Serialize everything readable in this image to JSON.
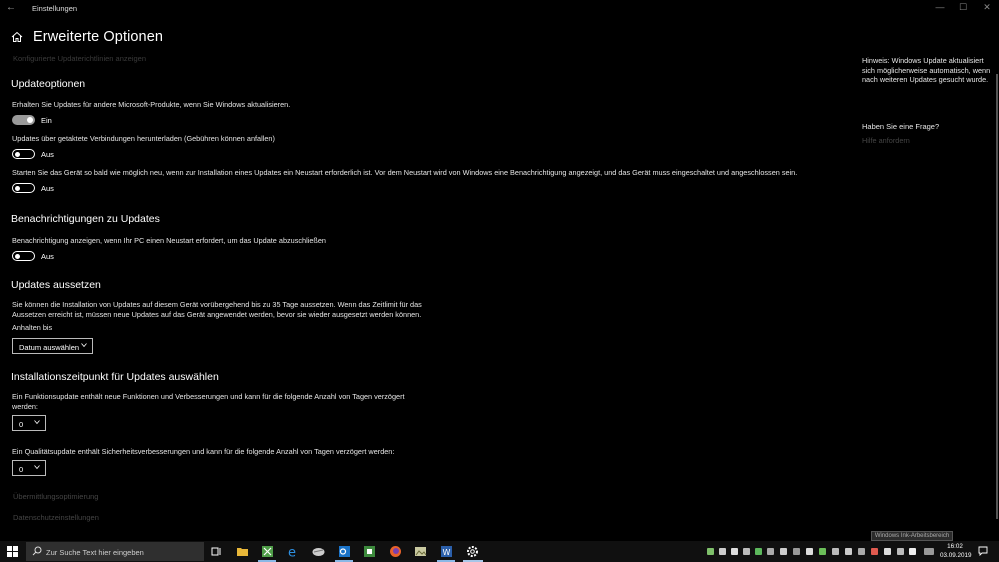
{
  "window": {
    "title": "Einstellungen",
    "back_glyph": "←",
    "minimize_glyph": "—",
    "maximize_glyph": "☐",
    "close_glyph": "✕"
  },
  "page": {
    "title": "Erweiterte Optionen",
    "subtitle_link": "Konfigurierte Updaterichtlinien anzeigen"
  },
  "update_options": {
    "heading": "Updateoptionen",
    "items": [
      {
        "label": "Erhalten Sie Updates für andere Microsoft-Produkte, wenn Sie Windows aktualisieren.",
        "state_text": "Ein",
        "on": true
      },
      {
        "label": "Updates über getaktete Verbindungen herunterladen (Gebühren können anfallen)",
        "state_text": "Aus",
        "on": false
      },
      {
        "label": "Starten Sie das Gerät so bald wie möglich neu, wenn zur Installation eines Updates ein Neustart erforderlich ist. Vor dem Neustart wird von Windows eine Benachrichtigung angezeigt, und das Gerät muss eingeschaltet und angeschlossen sein.",
        "state_text": "Aus",
        "on": false
      }
    ]
  },
  "notifications": {
    "heading": "Benachrichtigungen zu Updates",
    "label": "Benachrichtigung anzeigen, wenn Ihr PC einen Neustart erfordert, um das Update abzuschließen",
    "state_text": "Aus",
    "on": false
  },
  "pause": {
    "heading": "Updates aussetzen",
    "description_line1": "Sie können die Installation von Updates auf diesem Gerät vorübergehend bis zu 35 Tage aussetzen. Wenn das Zeitlimit für das",
    "description_line2": "Aussetzen erreicht ist, müssen neue Updates auf das Gerät angewendet werden, bevor sie wieder ausgesetzt werden können.",
    "until_label": "Anhalten bis",
    "date_dropdown": "Datum auswählen"
  },
  "install_time": {
    "heading": "Installationszeitpunkt für Updates auswählen",
    "feature_label_line1": "Ein Funktionsupdate enthält neue Funktionen und Verbesserungen und kann für die folgende Anzahl von Tagen verzögert",
    "feature_label_line2": "werden:",
    "feature_value": "0",
    "quality_label": "Ein Qualitätsupdate enthält Sicherheitsverbesserungen und kann für die folgende Anzahl von Tagen verzögert werden:",
    "quality_value": "0"
  },
  "links": {
    "delivery": "Übermittlungsoptimierung",
    "privacy": "Datenschutzeinstellungen"
  },
  "sidebar": {
    "hint": "Hinweis: Windows Update aktualisiert sich möglicherweise automatisch, wenn nach weiteren Updates gesucht wurde.",
    "question": "Haben Sie eine Frage?",
    "help_link": "Hilfe anfordern"
  },
  "tooltip": "Windows Ink-Arbeitsbereich",
  "taskbar": {
    "search_placeholder": "Zur Suche Text hier eingeben",
    "time": "16:02",
    "date": "03.09.2019",
    "apps": [
      "task-view-icon",
      "file-explorer-icon",
      "spreadsheet-app-icon",
      "edge-icon",
      "mail-app-icon",
      "outlook-icon",
      "project-app-icon",
      "firefox-icon",
      "photos-app-icon",
      "word-icon",
      "settings-icon"
    ]
  },
  "colors": {
    "accent": "#8ab8e6",
    "background": "#000000",
    "disabled_text": "#444444"
  }
}
